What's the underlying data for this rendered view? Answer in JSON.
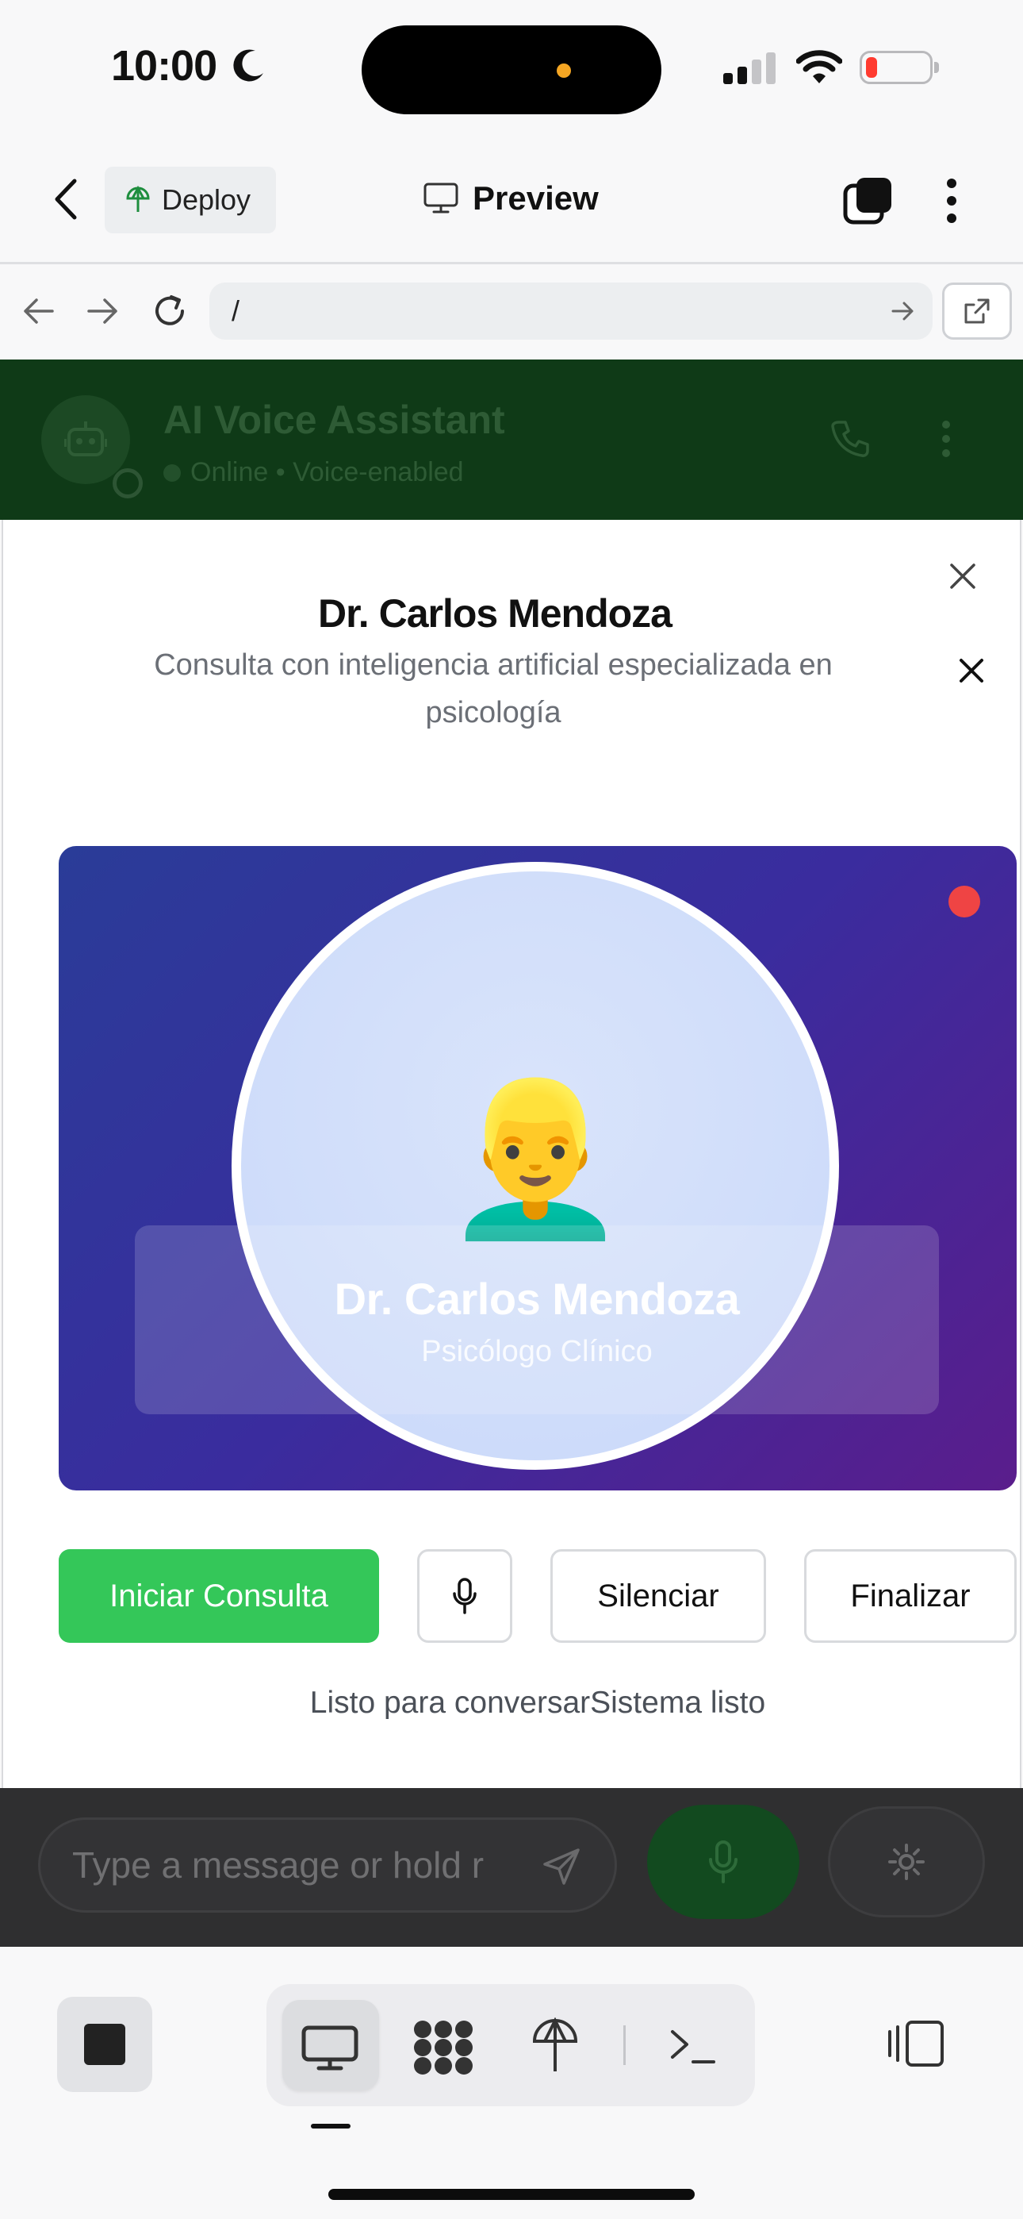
{
  "status_bar": {
    "time": "10:00"
  },
  "header": {
    "deploy_label": "Deploy",
    "preview_label": "Preview"
  },
  "browser": {
    "url": "/"
  },
  "background_app": {
    "title": "AI Voice Assistant",
    "subtitle": "Online • Voice-enabled",
    "input_placeholder": "Type a message or hold r"
  },
  "modal": {
    "title": "Dr. Carlos Mendoza",
    "subtitle": "Consulta con inteligencia artificial especializada en psicología",
    "avatar_emoji": "👱‍♂️",
    "card_name": "Dr. Carlos Mendoza",
    "card_role": "Psicólogo Clínico",
    "buttons": {
      "start": "Iniciar Consulta",
      "mute": "Silenciar",
      "end": "Finalizar"
    },
    "status": "Listo para conversarSistema listo"
  },
  "colors": {
    "start_button": "#34c759",
    "recording_dot": "#ef4444",
    "video_gradient_start": "#2a3c98",
    "video_gradient_end": "#5a1d8c",
    "background_header": "#0f3a17"
  }
}
